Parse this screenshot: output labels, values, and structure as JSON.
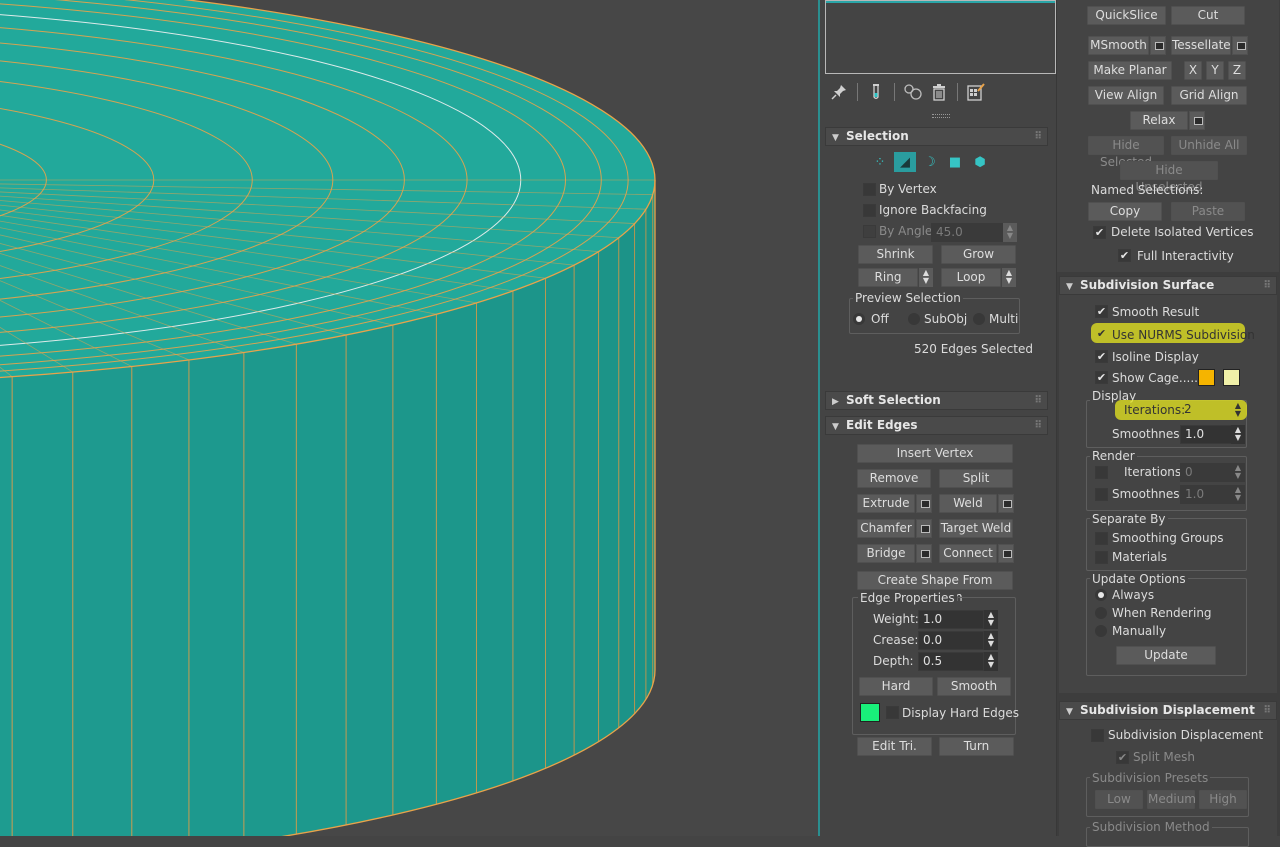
{
  "colors": {
    "mesh_fill": "#22a99b",
    "edge_selected": "#e9a34a",
    "accent": "#2a9d9f",
    "highlight": "#e8e81f",
    "cage_color_1": "#f5b400",
    "cage_color_2": "#f0f0a8",
    "hard_edge_color": "#19f07a"
  },
  "toolbar": {
    "icons": [
      "pin-stack-icon",
      "test-tube-icon",
      "unique-icon",
      "trash-icon",
      "configure-icon"
    ]
  },
  "selection": {
    "title": "Selection",
    "by_vertex": "By Vertex",
    "ignore_backfacing": "Ignore Backfacing",
    "by_angle_label": "By Angle:",
    "by_angle_value": "45.0",
    "shrink": "Shrink",
    "grow": "Grow",
    "ring": "Ring",
    "loop": "Loop",
    "preview_title": "Preview Selection",
    "preview_off": "Off",
    "preview_subobj": "SubObj",
    "preview_multi": "Multi",
    "status": "520 Edges Selected"
  },
  "soft_selection": {
    "title": "Soft Selection"
  },
  "edit_edges": {
    "title": "Edit Edges",
    "insert_vertex": "Insert Vertex",
    "remove": "Remove",
    "split": "Split",
    "extrude": "Extrude",
    "weld": "Weld",
    "chamfer": "Chamfer",
    "target_weld": "Target Weld",
    "bridge": "Bridge",
    "connect": "Connect",
    "create_shape": "Create Shape From Selection",
    "edge_props_title": "Edge Properties",
    "weight_label": "Weight:",
    "weight_value": "1.0",
    "crease_label": "Crease:",
    "crease_value": "0.0",
    "depth_label": "Depth:",
    "depth_value": "0.5",
    "hard": "Hard",
    "smooth": "Smooth",
    "display_hard_edges": "Display Hard Edges",
    "edit_tri": "Edit Tri.",
    "turn": "Turn"
  },
  "edit_geometry": {
    "quickslice": "QuickSlice",
    "cut": "Cut",
    "msmooth": "MSmooth",
    "tessellate": "Tessellate",
    "make_planar": "Make Planar",
    "x": "X",
    "y": "Y",
    "z": "Z",
    "view_align": "View Align",
    "grid_align": "Grid Align",
    "relax": "Relax",
    "hide_selected": "Hide Selected",
    "unhide_all": "Unhide All",
    "hide_unselected": "Hide Unselected",
    "named_selections": "Named Selections:",
    "copy": "Copy",
    "paste": "Paste",
    "delete_isolated": "Delete Isolated Vertices",
    "full_interactivity": "Full Interactivity"
  },
  "subdivision_surface": {
    "title": "Subdivision Surface",
    "smooth_result": "Smooth Result",
    "use_nurms": "Use NURMS Subdivision",
    "isoline_display": "Isoline Display",
    "show_cage": "Show Cage......",
    "display_title": "Display",
    "iterations_label": "Iterations:",
    "iterations_value": "2",
    "smoothness_label": "Smoothness:",
    "smoothness_value": "1.0",
    "render_title": "Render",
    "render_iterations_label": "Iterations:",
    "render_iterations_value": "0",
    "render_smoothness_label": "Smoothness:",
    "render_smoothness_value": "1.0",
    "separate_by_title": "Separate By",
    "smoothing_groups": "Smoothing Groups",
    "materials": "Materials",
    "update_options_title": "Update Options",
    "always": "Always",
    "when_rendering": "When Rendering",
    "manually": "Manually",
    "update": "Update"
  },
  "subdivision_displacement": {
    "title": "Subdivision Displacement",
    "subdivision_displacement": "Subdivision Displacement",
    "split_mesh": "Split Mesh",
    "presets_title": "Subdivision Presets",
    "low": "Low",
    "medium": "Medium",
    "high": "High",
    "method_title": "Subdivision Method"
  }
}
